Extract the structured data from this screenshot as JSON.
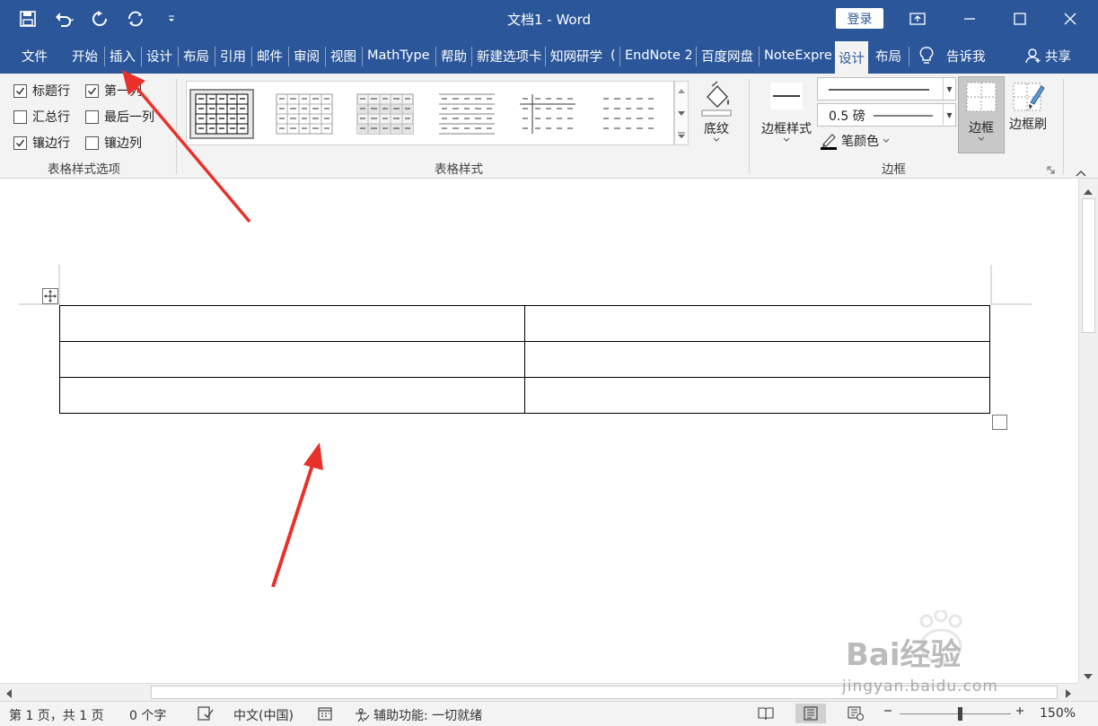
{
  "title": "文档1  -  Word",
  "login": "登录",
  "tabs": [
    "文件",
    "开始",
    "插入",
    "设计",
    "布局",
    "引用",
    "邮件",
    "审阅",
    "视图",
    "MathType",
    "帮助",
    "新建选项卡",
    "知网研学",
    "(",
    "EndNote 2",
    "百度网盘",
    "NoteExpre",
    "设计",
    "布局"
  ],
  "tell_me": "告诉我",
  "share": "共享",
  "options": {
    "header_row": "标题行",
    "first_col": "第一列",
    "total_row": "汇总行",
    "last_col": "最后一列",
    "banded_rows": "镶边行",
    "banded_cols": "镶边列",
    "group_label": "表格样式选项"
  },
  "styles": {
    "group_label": "表格样式",
    "shading": "底纹"
  },
  "borders": {
    "border_styles": "边框样式",
    "weight": "0.5 磅",
    "pen_color": "笔颜色",
    "borders_btn": "边框",
    "border_painter": "边框刷",
    "group_label": "边框"
  },
  "status": {
    "page": "第 1 页，共 1 页",
    "words": "0 个字",
    "language": "中文(中国)",
    "accessibility": "辅助功能: 一切就绪",
    "zoom": "150%"
  },
  "watermark": {
    "brand": "Bai经验",
    "url": "jingyan.baidu.com"
  },
  "colors": {
    "word_blue": "#2b579a",
    "ribbon_bg": "#f3f3f3",
    "arrow_red": "#e8312a"
  }
}
